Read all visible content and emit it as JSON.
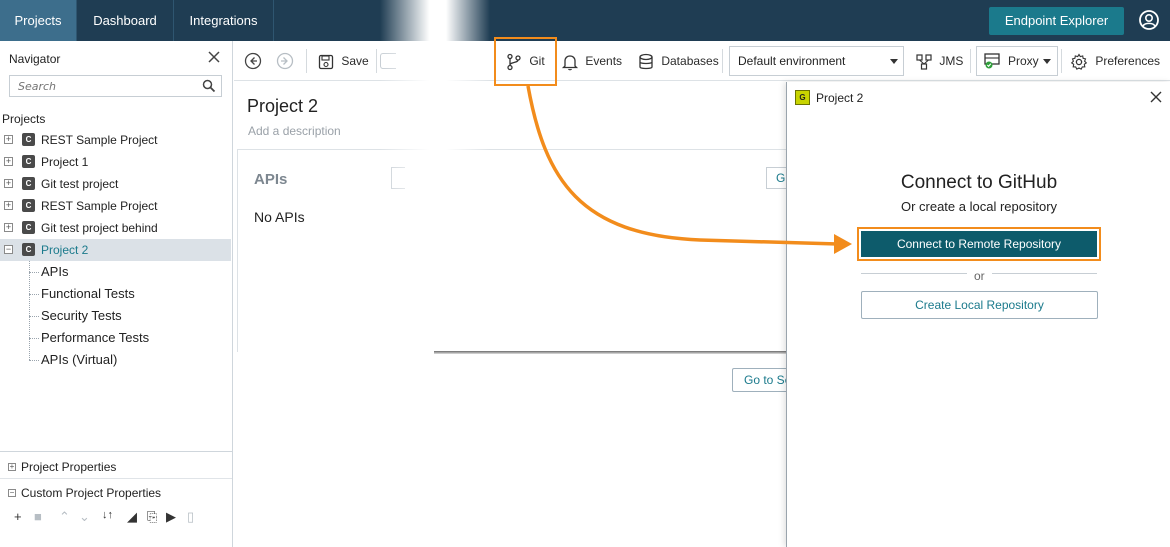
{
  "topbar": {
    "tabs": [
      {
        "label": "Projects",
        "active": true
      },
      {
        "label": "Dashboard",
        "active": false
      },
      {
        "label": "Integrations",
        "active": false
      }
    ],
    "endpoint_explorer": "Endpoint Explorer",
    "user_icon": "user-circle-icon"
  },
  "navigator": {
    "title": "Navigator",
    "search_placeholder": "Search",
    "projects_label": "Projects",
    "projects": [
      {
        "label": "REST Sample Project",
        "icon": "C"
      },
      {
        "label": "Project 1",
        "icon": "C"
      },
      {
        "label": "Git test project",
        "icon": "C"
      },
      {
        "label": "REST Sample Project",
        "icon": "C"
      },
      {
        "label": "Git test project behind",
        "icon": "C"
      },
      {
        "label": "Project 2",
        "icon": "C",
        "selected": true
      }
    ],
    "project2_children": [
      "APIs",
      "Functional Tests",
      "Security Tests",
      "Performance Tests",
      "APIs (Virtual)"
    ],
    "project_properties": "Project Properties",
    "custom_project_properties": "Custom Project Properties"
  },
  "toolbar": {
    "save": "Save",
    "git": "Git",
    "events": "Events",
    "databases": "Databases",
    "environment": "Default environment",
    "jms": "JMS",
    "proxy": "Proxy",
    "preferences": "Preferences"
  },
  "main": {
    "project_title": "Project 2",
    "description_placeholder": "Add a description",
    "apis_title": "APIs",
    "no_apis": "No APIs",
    "right_button_fragment": "G",
    "goto_fragment": "Go to Se"
  },
  "dialog": {
    "title": "Project 2",
    "heading": "Connect to GitHub",
    "subheading": "Or create a local repository",
    "remote_button": "Connect to Remote Repository",
    "or": "or",
    "local_button": "Create Local Repository"
  },
  "colors": {
    "topbar": "#1f3d53",
    "accent": "#1b7a8c",
    "primary_button": "#0d5b6b",
    "highlight": "#f28c1c"
  }
}
